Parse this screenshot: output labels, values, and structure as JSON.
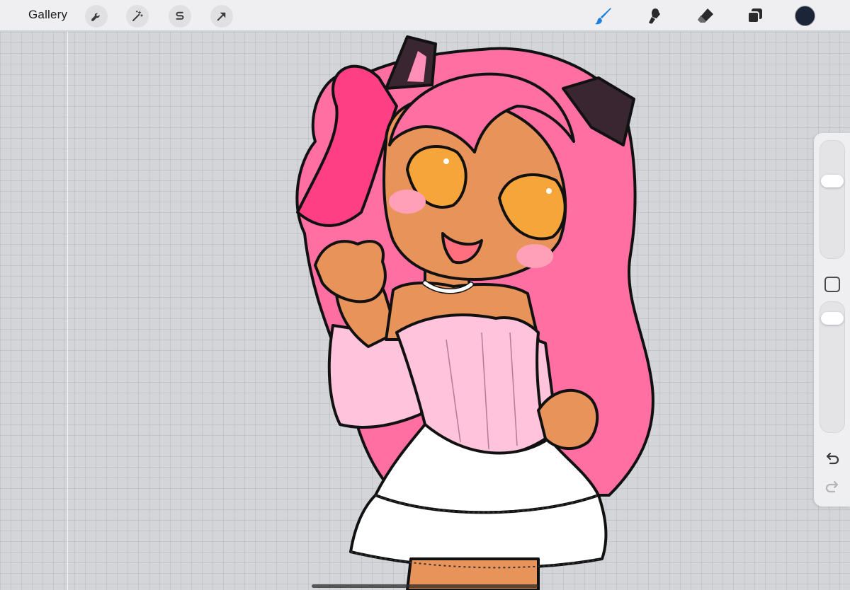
{
  "toolbar": {
    "gallery_label": "Gallery",
    "left_tools": [
      {
        "name": "wrench-icon",
        "action": "actions"
      },
      {
        "name": "magic-wand-icon",
        "action": "adjustments"
      },
      {
        "name": "selection-icon",
        "action": "selection"
      },
      {
        "name": "transform-arrow-icon",
        "action": "transform"
      }
    ],
    "right_tools": [
      {
        "name": "brush-icon",
        "action": "paint",
        "active": true
      },
      {
        "name": "smudge-icon",
        "action": "smudge"
      },
      {
        "name": "eraser-icon",
        "action": "erase"
      },
      {
        "name": "layers-icon",
        "action": "layers"
      }
    ],
    "active_color": "#1c2538",
    "active_tool_color": "#1a7fe0"
  },
  "sidebar": {
    "brush_size_level": 0.68,
    "brush_opacity_level": 0.92,
    "modify_button": "square-icon",
    "undo": "undo-icon",
    "redo": "redo-icon"
  },
  "canvas": {
    "background": "#d3d5d8",
    "character_colors": {
      "hair": "#ff6fa1",
      "hair_shadow": "#ff3f83",
      "skin": "#e8935a",
      "eyes": "#f5a53a",
      "blush": "#ff9fb8",
      "dress": "#ffc3dc",
      "skirt": "#ffffff",
      "ears": "#3a2630"
    }
  }
}
